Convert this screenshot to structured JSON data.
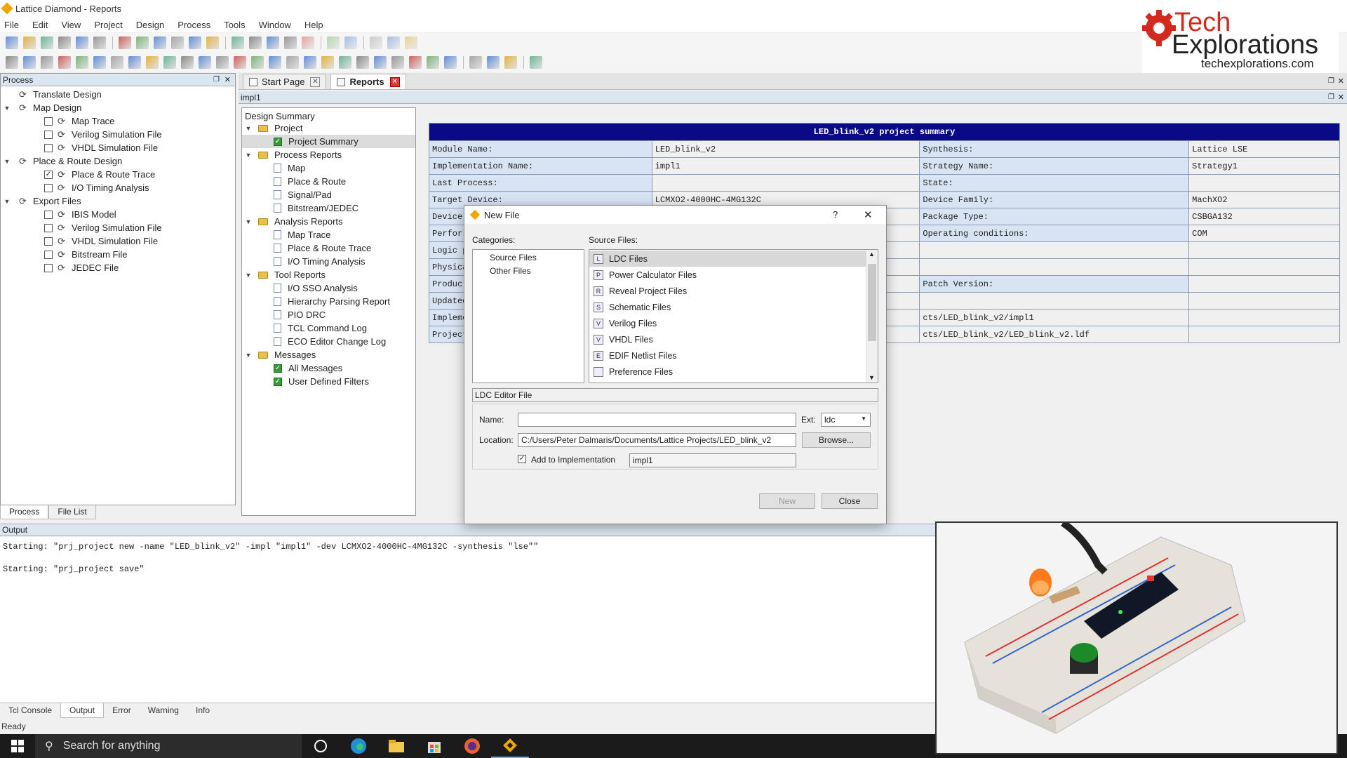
{
  "window": {
    "title": "Lattice Diamond - Reports"
  },
  "menu": [
    "File",
    "Edit",
    "View",
    "Project",
    "Design",
    "Process",
    "Tools",
    "Window",
    "Help"
  ],
  "process_panel": {
    "title": "Process",
    "items": [
      {
        "label": "Translate Design",
        "level": 0,
        "type": "step"
      },
      {
        "label": "Map Design",
        "level": 0,
        "type": "group"
      },
      {
        "label": "Map Trace",
        "level": 1,
        "checked": false
      },
      {
        "label": "Verilog Simulation File",
        "level": 1,
        "checked": false
      },
      {
        "label": "VHDL Simulation File",
        "level": 1,
        "checked": false
      },
      {
        "label": "Place & Route Design",
        "level": 0,
        "type": "group"
      },
      {
        "label": "Place & Route Trace",
        "level": 1,
        "checked": true
      },
      {
        "label": "I/O Timing Analysis",
        "level": 1,
        "checked": false
      },
      {
        "label": "Export Files",
        "level": 0,
        "type": "group"
      },
      {
        "label": "IBIS Model",
        "level": 1,
        "checked": false
      },
      {
        "label": "Verilog Simulation File",
        "level": 1,
        "checked": false
      },
      {
        "label": "VHDL Simulation File",
        "level": 1,
        "checked": false
      },
      {
        "label": "Bitstream File",
        "level": 1,
        "checked": false
      },
      {
        "label": "JEDEC File",
        "level": 1,
        "checked": false
      }
    ],
    "tabs": [
      "Process",
      "File List"
    ]
  },
  "doc_tabs": [
    {
      "label": "Start Page",
      "active": false
    },
    {
      "label": "Reports",
      "active": true
    }
  ],
  "impl_bar": "impl1",
  "design_summary": {
    "title": "Design Summary",
    "items": [
      {
        "label": "Project",
        "kind": "folder",
        "level": 0
      },
      {
        "label": "Project Summary",
        "kind": "gpage",
        "level": 1,
        "selected": true
      },
      {
        "label": "Process Reports",
        "kind": "folder",
        "level": 0
      },
      {
        "label": "Map",
        "kind": "page",
        "level": 1
      },
      {
        "label": "Place & Route",
        "kind": "page",
        "level": 1
      },
      {
        "label": "Signal/Pad",
        "kind": "page",
        "level": 1
      },
      {
        "label": "Bitstream/JEDEC",
        "kind": "page",
        "level": 1
      },
      {
        "label": "Analysis Reports",
        "kind": "folder",
        "level": 0
      },
      {
        "label": "Map Trace",
        "kind": "page",
        "level": 1
      },
      {
        "label": "Place & Route Trace",
        "kind": "page",
        "level": 1
      },
      {
        "label": "I/O Timing Analysis",
        "kind": "page",
        "level": 1
      },
      {
        "label": "Tool Reports",
        "kind": "folder",
        "level": 0
      },
      {
        "label": "I/O SSO Analysis",
        "kind": "page",
        "level": 1
      },
      {
        "label": "Hierarchy Parsing Report",
        "kind": "page",
        "level": 1
      },
      {
        "label": "PIO DRC",
        "kind": "page",
        "level": 1
      },
      {
        "label": "TCL Command Log",
        "kind": "page",
        "level": 1
      },
      {
        "label": "ECO Editor Change Log",
        "kind": "page",
        "level": 1
      },
      {
        "label": "Messages",
        "kind": "folder",
        "level": 0
      },
      {
        "label": "All Messages",
        "kind": "gpage",
        "level": 1
      },
      {
        "label": "User Defined Filters",
        "kind": "gpage",
        "level": 1
      }
    ]
  },
  "summary": {
    "header": "LED_blink_v2 project summary",
    "rows": [
      [
        "Module Name:",
        "LED_blink_v2",
        "Synthesis:",
        "Lattice LSE"
      ],
      [
        "Implementation Name:",
        "impl1",
        "Strategy Name:",
        "Strategy1"
      ],
      [
        "Last Process:",
        "",
        "State:",
        ""
      ],
      [
        "Target Device:",
        "LCMXO2-4000HC-4MG132C",
        "Device Family:",
        "MachXO2"
      ],
      [
        "Device",
        "",
        "Package Type:",
        "CSBGA132"
      ],
      [
        "Perfor",
        "",
        "Operating conditions:",
        "COM"
      ],
      [
        "Logic p",
        "",
        "",
        ""
      ],
      [
        "Physica",
        "",
        "",
        ""
      ],
      [
        "Produc",
        "",
        "Patch Version:",
        ""
      ],
      [
        "Updated",
        "",
        "",
        ""
      ],
      [
        "Impleme",
        "",
        "cts/LED_blink_v2/impl1",
        ""
      ],
      [
        "Project",
        "",
        "cts/LED_blink_v2/LED_blink_v2.ldf",
        ""
      ]
    ]
  },
  "dialog": {
    "title": "New File",
    "help": "?",
    "close_glyph": "✕",
    "categories_label": "Categories:",
    "categories": [
      "Source Files",
      "Other Files"
    ],
    "source_files_label": "Source Files:",
    "source_files": [
      {
        "label": "LDC Files",
        "icon": "ldc-icon",
        "glyph": "L"
      },
      {
        "label": "Power Calculator Files",
        "icon": "power-calculator-icon",
        "glyph": "P"
      },
      {
        "label": "Reveal Project Files",
        "icon": "reveal-icon",
        "glyph": "R"
      },
      {
        "label": "Schematic Files",
        "icon": "schematic-icon",
        "glyph": "S"
      },
      {
        "label": "Verilog Files",
        "icon": "verilog-icon",
        "glyph": "V"
      },
      {
        "label": "VHDL Files",
        "icon": "vhdl-icon",
        "glyph": "V"
      },
      {
        "label": "EDIF Netlist Files",
        "icon": "edif-icon",
        "glyph": "E"
      },
      {
        "label": "Preference Files",
        "icon": "preference-icon",
        "glyph": ""
      }
    ],
    "description": "LDC Editor File",
    "name_label": "Name:",
    "name_value": "",
    "ext_label": "Ext:",
    "ext_value": "ldc",
    "location_label": "Location:",
    "location_value": "C:/Users/Peter Dalmaris/Documents/Lattice Projects/LED_blink_v2",
    "browse_label": "Browse...",
    "add_impl_label": "Add to Implementation",
    "add_impl_checked": true,
    "impl_value": "impl1",
    "new_label": "New",
    "close_label": "Close"
  },
  "output": {
    "title": "Output",
    "lines": [
      "Starting: \"prj_project new -name \"LED_blink_v2\" -impl \"impl1\" -dev LCMXO2-4000HC-4MG132C -synthesis \"lse\"\"",
      "Starting: \"prj_project save\""
    ],
    "tabs": [
      "Tcl Console",
      "Output",
      "Error",
      "Warning",
      "Info"
    ],
    "active_tab": "Output"
  },
  "status": "Ready",
  "taskbar": {
    "search_placeholder": "Search for anything"
  },
  "logo": {
    "line1": "Tech",
    "line2": "Explorations",
    "url": "techexplorations.com"
  },
  "colors": {
    "summary_header": "#0a0a86",
    "label_cell": "#d8e4f4",
    "logo_red": "#d42a1e"
  }
}
